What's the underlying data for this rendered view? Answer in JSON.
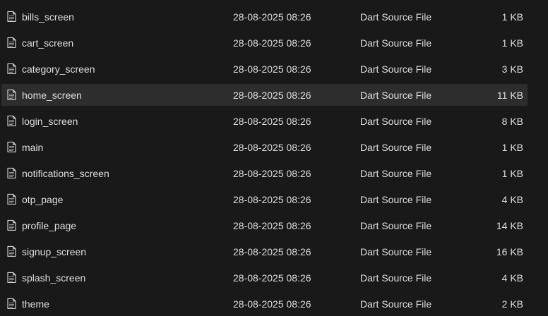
{
  "files": [
    {
      "name": "bills_screen",
      "date": "28-08-2025 08:26",
      "type": "Dart Source File",
      "size": "1 KB",
      "selected": false
    },
    {
      "name": "cart_screen",
      "date": "28-08-2025 08:26",
      "type": "Dart Source File",
      "size": "1 KB",
      "selected": false
    },
    {
      "name": "category_screen",
      "date": "28-08-2025 08:26",
      "type": "Dart Source File",
      "size": "3 KB",
      "selected": false
    },
    {
      "name": "home_screen",
      "date": "28-08-2025 08:26",
      "type": "Dart Source File",
      "size": "11 KB",
      "selected": true
    },
    {
      "name": "login_screen",
      "date": "28-08-2025 08:26",
      "type": "Dart Source File",
      "size": "8 KB",
      "selected": false
    },
    {
      "name": "main",
      "date": "28-08-2025 08:26",
      "type": "Dart Source File",
      "size": "1 KB",
      "selected": false
    },
    {
      "name": "notifications_screen",
      "date": "28-08-2025 08:26",
      "type": "Dart Source File",
      "size": "1 KB",
      "selected": false
    },
    {
      "name": "otp_page",
      "date": "28-08-2025 08:26",
      "type": "Dart Source File",
      "size": "4 KB",
      "selected": false
    },
    {
      "name": "profile_page",
      "date": "28-08-2025 08:26",
      "type": "Dart Source File",
      "size": "14 KB",
      "selected": false
    },
    {
      "name": "signup_screen",
      "date": "28-08-2025 08:26",
      "type": "Dart Source File",
      "size": "16 KB",
      "selected": false
    },
    {
      "name": "splash_screen",
      "date": "28-08-2025 08:26",
      "type": "Dart Source File",
      "size": "4 KB",
      "selected": false
    },
    {
      "name": "theme",
      "date": "28-08-2025 08:26",
      "type": "Dart Source File",
      "size": "2 KB",
      "selected": false
    }
  ],
  "icons": {
    "file": "document-icon"
  },
  "colors": {
    "background": "#191919",
    "selected_row": "#2d2d2d",
    "text": "#dedede"
  }
}
